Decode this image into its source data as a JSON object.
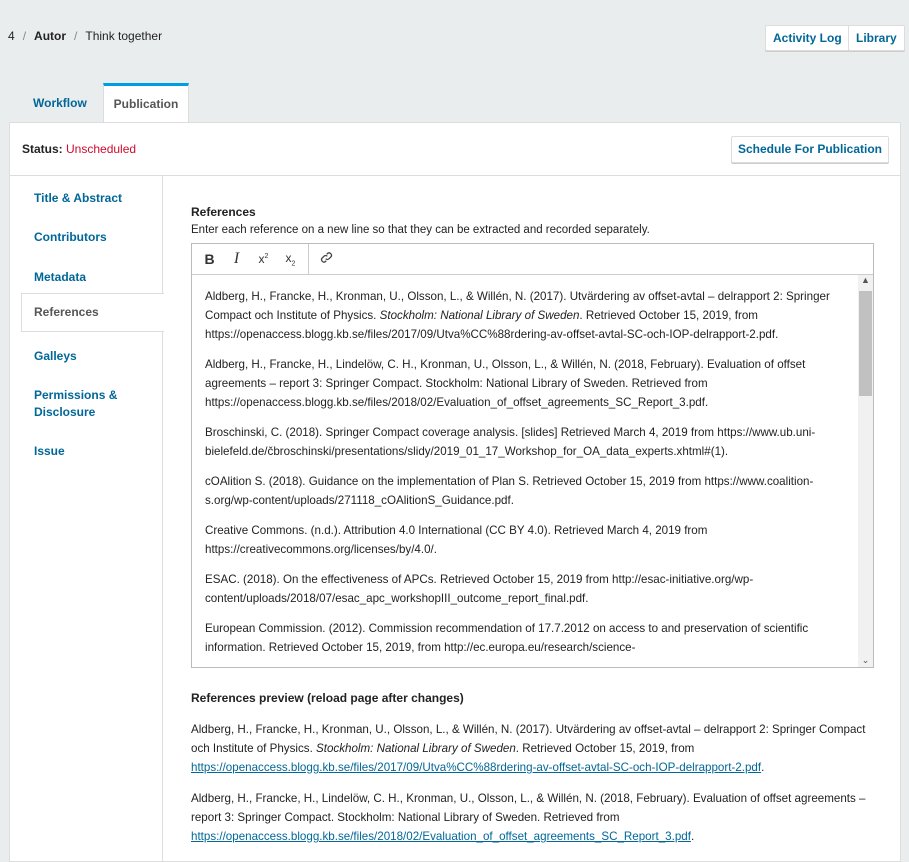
{
  "breadcrumb": {
    "id": "4",
    "author": "Autor",
    "title": "Think together"
  },
  "header": {
    "activity_log": "Activity Log",
    "library": "Library"
  },
  "tabs": [
    {
      "label": "Workflow"
    },
    {
      "label": "Publication"
    }
  ],
  "status": {
    "label": "Status:",
    "value": "Unscheduled",
    "color": "#d00a2d"
  },
  "schedule_button": "Schedule For Publication",
  "sidebar": {
    "items": [
      {
        "label": "Title & Abstract"
      },
      {
        "label": "Contributors"
      },
      {
        "label": "Metadata"
      },
      {
        "label": "References",
        "active": true
      },
      {
        "label": "Galleys"
      },
      {
        "label": "Permissions & Disclosure"
      },
      {
        "label": "Issue"
      }
    ]
  },
  "references": {
    "label": "References",
    "help": "Enter each reference on a new line so that they can be extracted and recorded separately.",
    "toolbar": [
      "bold-icon",
      "italic-icon",
      "superscript-icon",
      "subscript-icon",
      "link-icon"
    ],
    "entries": [
      {
        "pre": "Aldberg, H., Francke, H., Kronman, U., Olsson, L., & Willén, N. (2017). Utvärdering av offset-avtal – delrapport 2: Springer Compact och Institute of Physics. ",
        "em": "Stockholm: National Library of Sweden",
        "post": ". Retrieved October 15, 2019, from https://openaccess.blogg.kb.se/files/2017/09/Utva%CC%88rdering-av-offset-avtal-SC-och-IOP-delrapport-2.pdf."
      },
      {
        "pre": "Aldberg, H., Francke, H., Lindelöw, C. H., Kronman, U., Olsson, L., & Willén, N. (2018, February). Evaluation of offset agreements – report 3: Springer Compact. Stockholm: National Library of Sweden. Retrieved from https://openaccess.blogg.kb.se/files/2018/02/Evaluation_of_offset_agreements_SC_Report_3.pdf."
      },
      {
        "pre": "Broschinski, C. (2018). Springer Compact coverage analysis. [slides] Retrieved March 4, 2019 from https://www.ub.uni-bielefeld.de/čbroschinski/presentations/slidy/2019_01_17_Workshop_for_OA_data_experts.xhtml#(1)."
      },
      {
        "pre": "cOAlition S. (2018). Guidance on the implementation of Plan S. Retrieved October 15, 2019 from https://www.coalition-s.org/wp-content/uploads/271118_cOAlitionS_Guidance.pdf."
      },
      {
        "pre": "Creative Commons. (n.d.). Attribution 4.0 International (CC BY 4.0). Retrieved March 4, 2019 from https://creativecommons.org/licenses/by/4.0/."
      },
      {
        "pre": "ESAC. (2018). On the effectiveness of APCs. Retrieved October 15, 2019 from http://esac-initiative.org/wp-content/uploads/2018/07/esac_apc_workshopIII_outcome_report_final.pdf."
      },
      {
        "pre": "European Commission. (2012). Commission recommendation of 17.7.2012 on access to and preservation of scientific information. Retrieved October 15, 2019, from http://ec.europa.eu/research/science-"
      }
    ]
  },
  "preview": {
    "label": "References preview (reload page after changes)",
    "entries": [
      {
        "pre": "Aldberg, H., Francke, H., Kronman, U., Olsson, L., & Willén, N. (2017). Utvärdering av offset-avtal – delrapport 2: Springer Compact och Institute of Physics. ",
        "em": "Stockholm: National Library of Sweden",
        "post": ". Retrieved October 15, 2019, from ",
        "link": "https://openaccess.blogg.kb.se/files/2017/09/Utva%CC%88rdering-av-offset-avtal-SC-och-IOP-delrapport-2.pdf",
        "end": "."
      },
      {
        "pre": "Aldberg, H., Francke, H., Lindelöw, C. H., Kronman, U., Olsson, L., & Willén, N. (2018, February). Evaluation of offset agreements – report 3: Springer Compact. Stockholm: National Library of Sweden. Retrieved from ",
        "link": "https://openaccess.blogg.kb.se/files/2018/02/Evaluation_of_offset_agreements_SC_Report_3.pdf",
        "end": "."
      }
    ]
  }
}
